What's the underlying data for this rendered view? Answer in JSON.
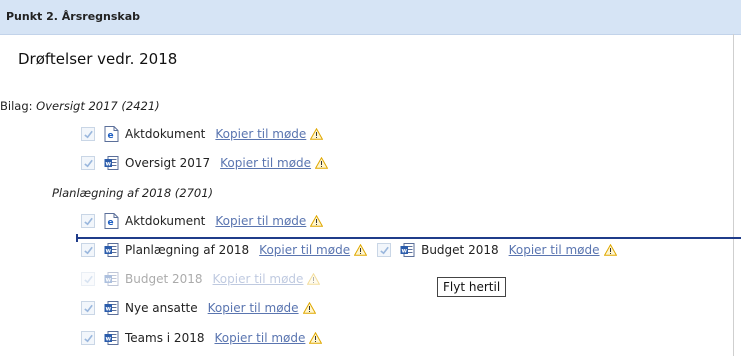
{
  "header": {
    "title": "Punkt 2.  Årsregnskab"
  },
  "heading": "Drøftelser vedr. 2018",
  "bilag": {
    "prefix": "Bilag: ",
    "name": "Oversigt 2017 (2421)"
  },
  "subgroup": "Planlægning af 2018 (2701)",
  "copy_link_label": "Kopier til møde",
  "items": [
    {
      "label": "Aktdokument",
      "icon": "edge-document-icon"
    },
    {
      "label": "Oversigt 2017",
      "icon": "word-document-icon"
    },
    {
      "label": "Aktdokument",
      "icon": "edge-document-icon"
    },
    {
      "label": "Planlægning af 2018",
      "icon": "word-document-icon"
    },
    {
      "label": "Budget 2018",
      "icon": "word-document-icon"
    },
    {
      "label": "Budget 2018",
      "icon": "word-document-icon",
      "state": "being-dragged"
    },
    {
      "label": "Nye ansatte",
      "icon": "word-document-icon"
    },
    {
      "label": "Teams i 2018",
      "icon": "word-document-icon"
    }
  ],
  "tooltip": "Flyt hertil",
  "colors": {
    "header_bg": "#d6e4f5",
    "link": "#5a75b0",
    "drop_line": "#1f3c8a",
    "warning": "#f0b400"
  }
}
